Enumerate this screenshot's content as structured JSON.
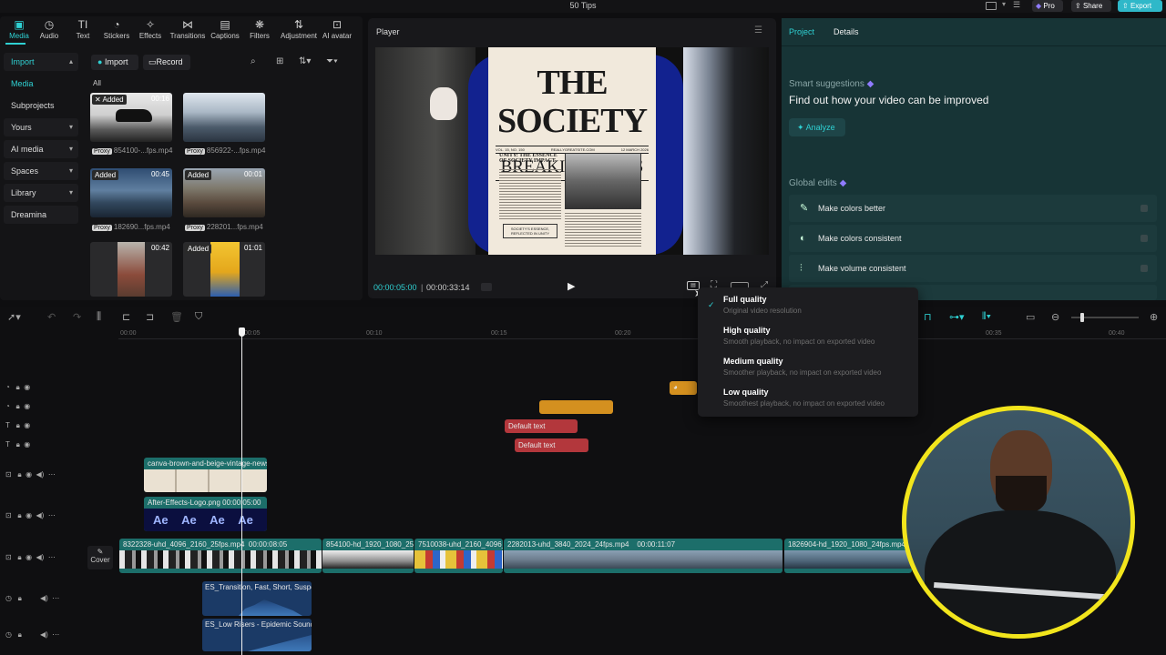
{
  "window": {
    "title": "50 Tips"
  },
  "topbar": {
    "pro_label": "Pro",
    "share_label": "Share",
    "export_label": "Export"
  },
  "toolbar": [
    "Media",
    "Audio",
    "Text",
    "Stickers",
    "Effects",
    "Transitions",
    "Captions",
    "Filters",
    "Adjustment",
    "AI avatar"
  ],
  "leftnav": [
    {
      "label": "Import",
      "chevron": "▴"
    },
    {
      "label": "Media",
      "chevron": ""
    },
    {
      "label": "Subprojects",
      "chevron": ""
    },
    {
      "label": "Yours",
      "chevron": "▾"
    },
    {
      "label": "AI media",
      "chevron": "▾"
    },
    {
      "label": "Spaces",
      "chevron": "▾"
    },
    {
      "label": "Library",
      "chevron": "▾"
    },
    {
      "label": "Dreamina",
      "chevron": ""
    }
  ],
  "media": {
    "import_label": "Import",
    "record_label": "Record",
    "filter_all": "All",
    "items": [
      {
        "badge": "Added",
        "duration": "00:16",
        "proxy": "Proxy",
        "name": "854100-...fps.mp4"
      },
      {
        "badge": "",
        "duration": "",
        "proxy": "Proxy",
        "name": "856922-...fps.mp4"
      },
      {
        "badge": "Added",
        "duration": "00:45",
        "proxy": "Proxy",
        "name": "182690...fps.mp4"
      },
      {
        "badge": "Added",
        "duration": "00:01",
        "proxy": "Proxy",
        "name": "228201...fps.mp4"
      },
      {
        "badge": "",
        "duration": "00:42",
        "proxy": "",
        "name": ""
      },
      {
        "badge": "Added",
        "duration": "01:01",
        "proxy": "",
        "name": ""
      }
    ]
  },
  "player": {
    "title": "Player",
    "current_time": "00:00:05:00",
    "total_time": "00:00:33:14",
    "newspaper": {
      "masthead": "THE SOCIETY",
      "headline": "BREAKING NEWS",
      "sub_left": "VOL. 15, NO. 150",
      "sub_mid": "REALLYGREATSITE.COM",
      "sub_right": "12 MARCH 2026",
      "col_head": "UNITY: THE ESSENCE OF SOCIETY IMPACT",
      "box_text": "SOCIETY'S ESSENCE, REFLECTED IN UNITY"
    }
  },
  "right": {
    "tabs": [
      "Project",
      "Details"
    ],
    "smart_title": "Smart suggestions",
    "smart_heading": "Find out how your video can be improved",
    "analyze_label": "Analyze",
    "global_title": "Global edits",
    "edits": [
      "Make colors better",
      "Make colors consistent",
      "Make volume consistent"
    ]
  },
  "quality_menu": [
    {
      "label": "Full quality",
      "desc": "Original video resolution",
      "checked": true
    },
    {
      "label": "High quality",
      "desc": "Smooth playback, no impact on exported video",
      "checked": false
    },
    {
      "label": "Medium quality",
      "desc": "Smoother playback, no impact on exported video",
      "checked": false
    },
    {
      "label": "Low quality",
      "desc": "Smoothest playback, no impact on exported video",
      "checked": false
    }
  ],
  "timeline": {
    "ticks": [
      "00:00",
      "00:05",
      "00:10",
      "00:15",
      "00:20",
      "00:35",
      "00:40"
    ],
    "cover_label": "Cover",
    "text_clips": [
      "Default text",
      "Default text"
    ],
    "overlay_clips": [
      {
        "name": "canva-brown-and-beige-vintage-news",
        "time": ""
      },
      {
        "name": "After-Effects-Logo.png",
        "time": "00:00:05:00"
      }
    ],
    "ae_label": "Ae",
    "main_clips": [
      {
        "name": "8322328-uhd_4096_2160_25fps.mp4",
        "time": "00:00:08:05"
      },
      {
        "name": "854100-hd_1920_1080_25fp",
        "time": ""
      },
      {
        "name": "7510038-uhd_2160_4096_2",
        "time": ""
      },
      {
        "name": "2282013-uhd_3840_2024_24fps.mp4",
        "time": "00:00:11:07"
      },
      {
        "name": "1826904-hd_1920_1080_24fps.mp4",
        "time": ""
      }
    ],
    "audio_clips": [
      "ES_Transition, Fast, Short, Suspen",
      "ES_Low Risers - Epidemic Sound.m"
    ]
  },
  "colors": {
    "accent": "#2fd1d3",
    "export": "#2fb8c9",
    "text_clip": "#b3373c",
    "sticker_clip": "#d4901f",
    "video_clip": "#1c6e6a",
    "audio_clip": "#1b3a66",
    "ring": "#f2e51c"
  },
  "icons": [
    "media-icon",
    "audio-icon",
    "text-icon",
    "sticker-icon",
    "effects-icon",
    "transitions-icon",
    "captions-icon",
    "filters-icon",
    "adjustment-icon",
    "ai-avatar-icon",
    "search-icon",
    "play-icon",
    "check-icon",
    "lock-icon",
    "eye-icon",
    "speaker-icon"
  ]
}
